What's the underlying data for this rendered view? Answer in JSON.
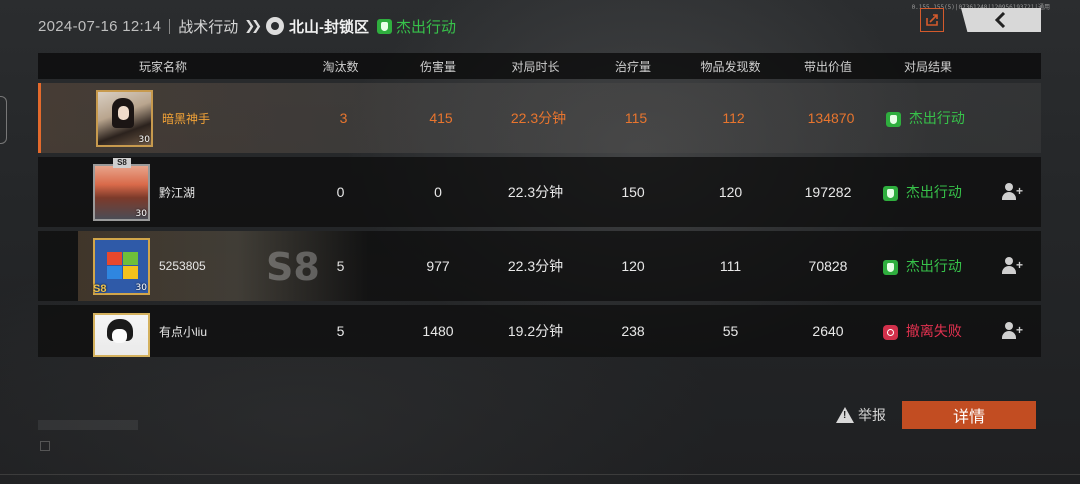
{
  "header": {
    "datetime": "2024-07-16 12:14",
    "mode": "战术行动",
    "map": "北山-封锁区",
    "result": "杰出行动"
  },
  "top_right": {
    "info_text": "0.155.155(5)|07361248|120956193721|通用"
  },
  "columns": [
    "玩家名称",
    "淘汰数",
    "伤害量",
    "对局时长",
    "治疗量",
    "物品发现数",
    "带出价值",
    "对局结果"
  ],
  "players": [
    {
      "name": "暗黑神手",
      "level": "30",
      "eliminations": "3",
      "damage": "415",
      "duration": "22.3分钟",
      "healing": "115",
      "items_found": "112",
      "extract_value": "134870",
      "result": "杰出行动",
      "result_type": "success"
    },
    {
      "name": "黔江湖",
      "level": "30",
      "badge": "S8",
      "eliminations": "0",
      "damage": "0",
      "duration": "22.3分钟",
      "healing": "150",
      "items_found": "120",
      "extract_value": "197282",
      "result": "杰出行动",
      "result_type": "success"
    },
    {
      "name": "5253805",
      "level": "30",
      "badge": "S8",
      "banner_text": "S8",
      "eliminations": "5",
      "damage": "977",
      "duration": "22.3分钟",
      "healing": "120",
      "items_found": "111",
      "extract_value": "70828",
      "result": "杰出行动",
      "result_type": "success"
    },
    {
      "name": "有点小liu",
      "eliminations": "5",
      "damage": "1480",
      "duration": "19.2分钟",
      "healing": "238",
      "items_found": "55",
      "extract_value": "2640",
      "result": "撤离失败",
      "result_type": "fail"
    }
  ],
  "footer": {
    "report_label": "举报",
    "details_label": "详情"
  },
  "colors": {
    "accent": "#c24d22",
    "success": "#37c24a",
    "fail": "#e0314f",
    "self_highlight": "#e8752e"
  }
}
